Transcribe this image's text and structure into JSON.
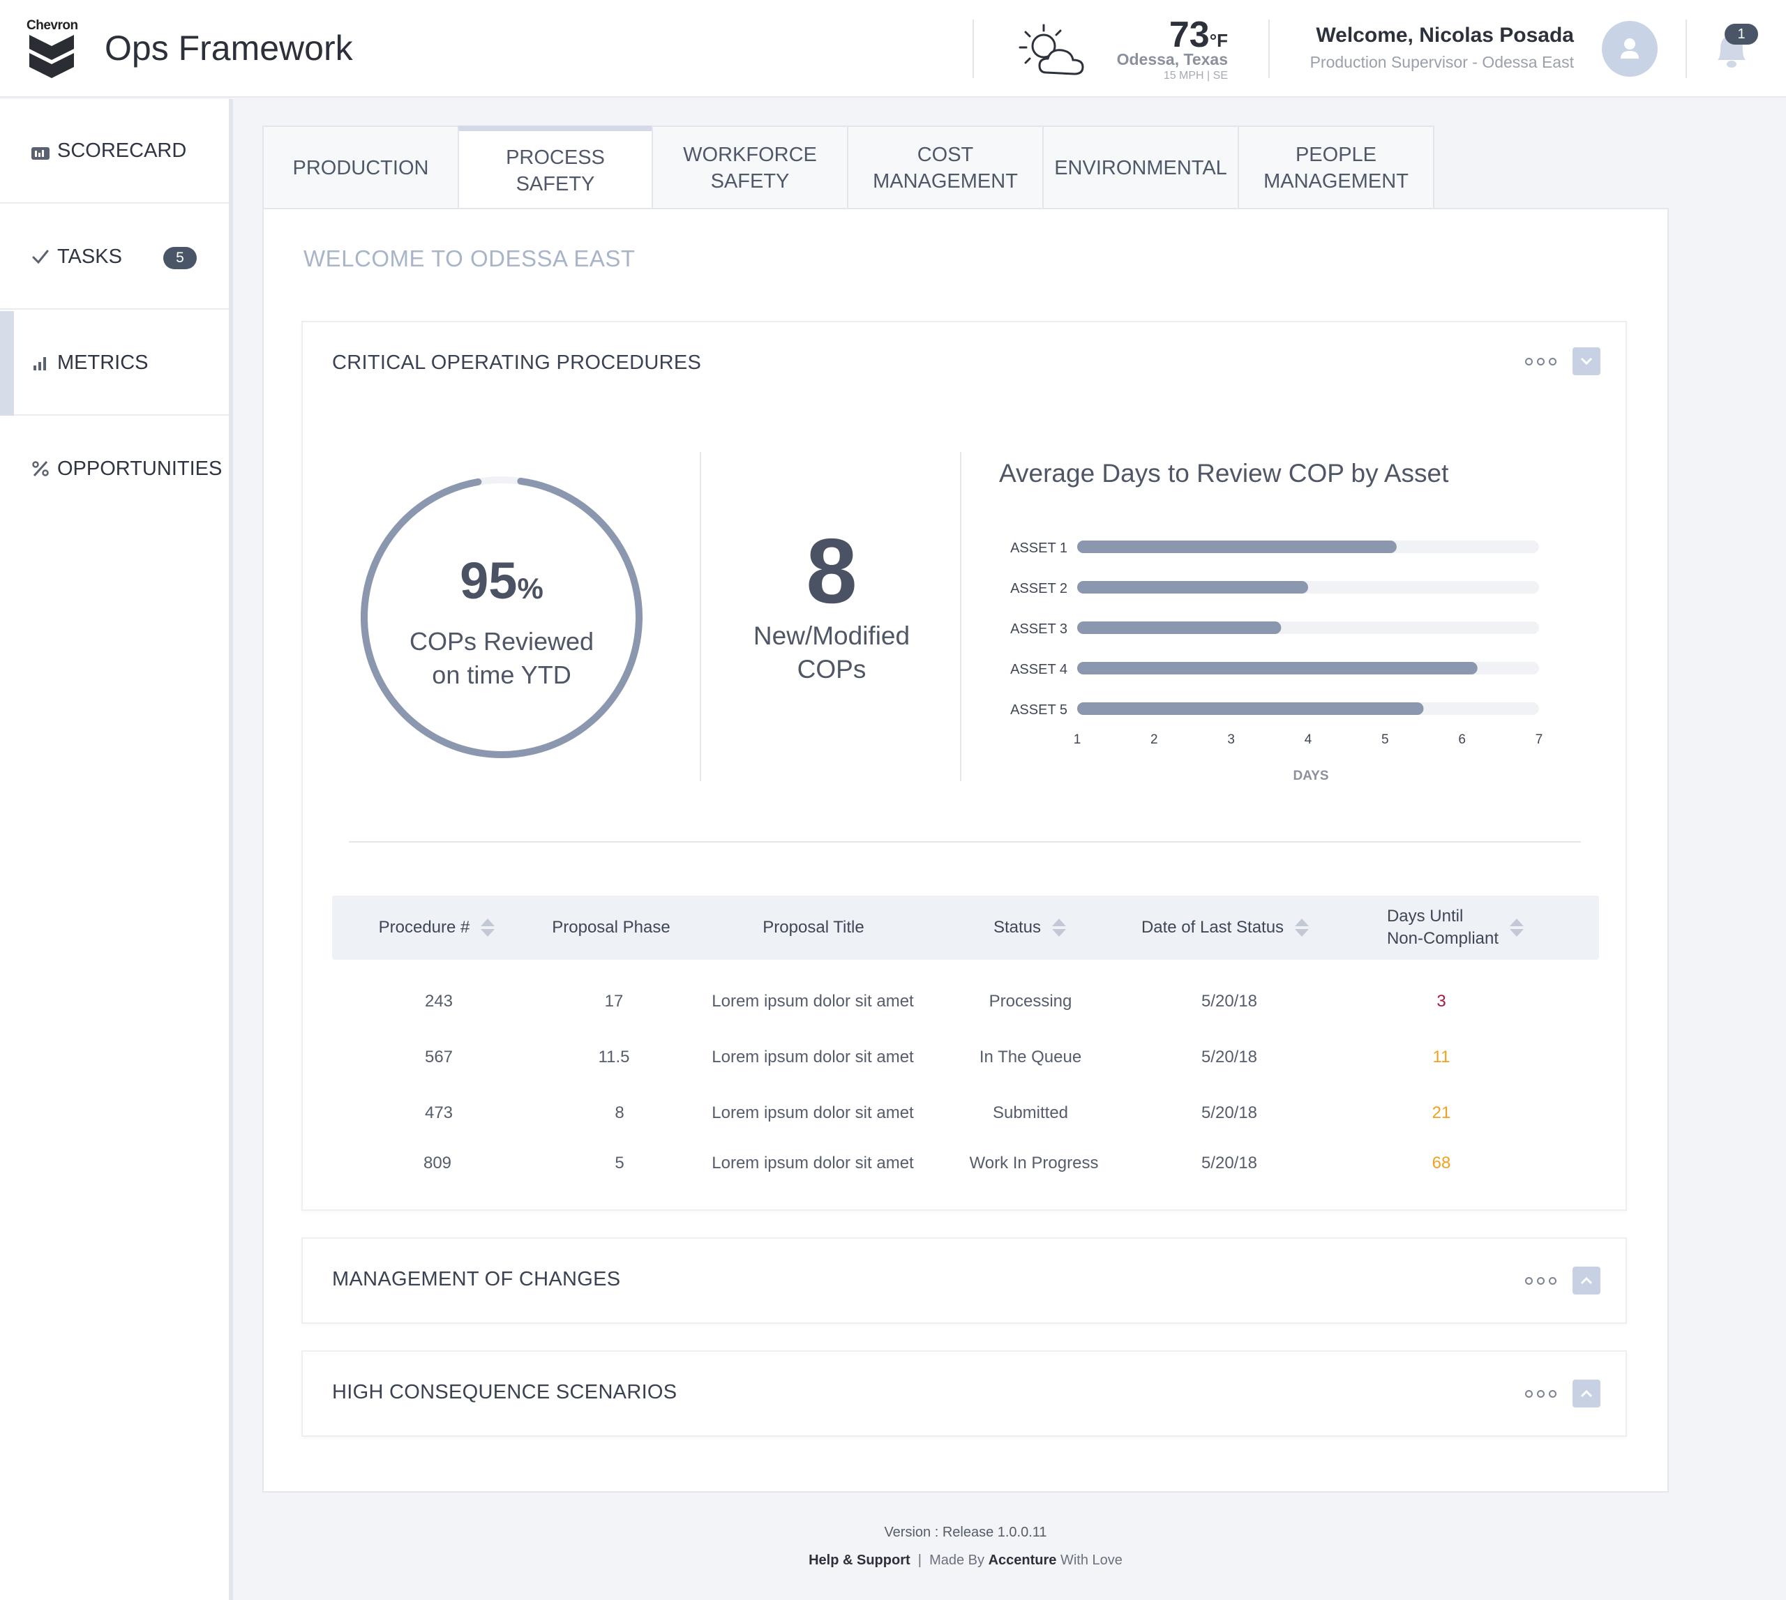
{
  "header": {
    "logo_text": "Chevron",
    "app_title": "Ops Framework",
    "weather": {
      "temp": "73",
      "unit": "°F",
      "city": "Odessa, Texas",
      "wind": "15 MPH | SE"
    },
    "welcome": "Welcome, Nicolas Posada",
    "role": "Production Supervisor - Odessa  East",
    "notifications": "1"
  },
  "sidebar": {
    "items": [
      {
        "label": "SCORECARD",
        "icon": "scorecard-icon"
      },
      {
        "label": "TASKS",
        "icon": "check-icon",
        "badge": "5"
      },
      {
        "label": "METRICS",
        "icon": "bar-chart-icon"
      },
      {
        "label": "OPPORTUNITIES",
        "icon": "percent-icon"
      }
    ],
    "active": "METRICS"
  },
  "tabs": [
    {
      "line1": "PRODUCTION",
      "line2": ""
    },
    {
      "line1": "PROCESS",
      "line2": "SAFETY"
    },
    {
      "line1": "WORKFORCE",
      "line2": "SAFETY"
    },
    {
      "line1": "COST",
      "line2": "MANAGEMENT"
    },
    {
      "line1": "ENVIRONMENTAL",
      "line2": ""
    },
    {
      "line1": "PEOPLE",
      "line2": "MANAGEMENT"
    }
  ],
  "main": {
    "welcome_title": "WELCOME TO ODESSA EAST",
    "cop_card": {
      "title": "CRITICAL OPERATING PROCEDURES",
      "kpi_value": "95",
      "kpi_unit": "%",
      "kpi_fraction": 0.95,
      "kpi_label_1": "COPs Reviewed",
      "kpi_label_2": "on time YTD",
      "count_value": "8",
      "count_label_1": "New/Modified",
      "count_label_2": "COPs"
    },
    "other_cards": [
      {
        "title": "MANAGEMENT OF CHANGES"
      },
      {
        "title": "HIGH CONSEQUENCE SCENARIOS"
      }
    ]
  },
  "chart_data": {
    "type": "bar",
    "orientation": "horizontal",
    "title": "Average Days to Review COP by Asset",
    "categories": [
      "ASSET 1",
      "ASSET 2",
      "ASSET 3",
      "ASSET 4",
      "ASSET 5"
    ],
    "values": [
      5.15,
      4.0,
      3.65,
      6.2,
      5.5
    ],
    "xlabel": "DAYS",
    "xlim": [
      1,
      7
    ],
    "xticks": [
      "1",
      "2",
      "3",
      "4",
      "5",
      "6",
      "7"
    ],
    "bar_color": "#8b97ae",
    "track_color": "#f1f2f5"
  },
  "table": {
    "headers": {
      "procedure": "Procedure #",
      "phase": "Proposal Phase",
      "title": "Proposal Title",
      "status": "Status",
      "date": "Date of Last Status",
      "days_1": "Days Until",
      "days_2": "Non-Compliant"
    },
    "rows": [
      {
        "procedure": "243",
        "phase": "17",
        "title": "Lorem ipsum dolor sit amet",
        "status": "Processing",
        "date": "5/20/18",
        "days": "3",
        "days_color": "#a6193c"
      },
      {
        "procedure": "567",
        "phase": "11.5",
        "title": "Lorem ipsum dolor sit amet",
        "status": "In The Queue",
        "date": "5/20/18",
        "days": "11",
        "days_color": "#f0a21e"
      },
      {
        "procedure": "473",
        "phase": "8",
        "title": "Lorem ipsum dolor sit amet",
        "status": "Submitted",
        "date": "5/20/18",
        "days": "21",
        "days_color": "#f0a21e"
      },
      {
        "procedure": "809",
        "phase": "5",
        "title": "Lorem ipsum dolor sit amet",
        "status": "Work In Progress",
        "date": "5/20/18",
        "days": "68",
        "days_color": "#f0a21e"
      }
    ]
  },
  "footer": {
    "version": "Version : Release 1.0.0.11",
    "help": "Help & Support",
    "sep": "|",
    "made_by_pre": "Made By",
    "made_by_company": "Accenture",
    "made_by_post": "With Love"
  }
}
